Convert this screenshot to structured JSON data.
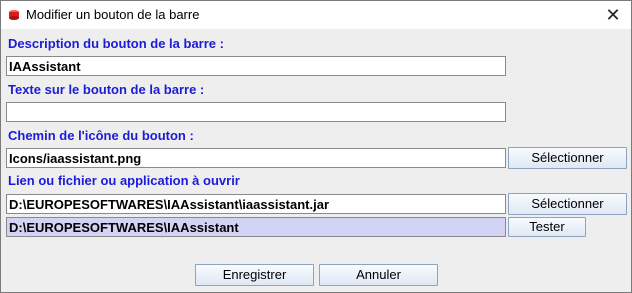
{
  "window": {
    "title": "Modifier un bouton de la barre",
    "close_glyph": "✕"
  },
  "form": {
    "description_label": "Description du bouton de la barre :",
    "description_value": "IAAssistant",
    "text_label": "Texte sur le bouton de la barre :",
    "text_value": "",
    "icon_path_label": "Chemin de l'icône du bouton :",
    "icon_path_value": "Icons/iaassistant.png",
    "icon_select_button": "Sélectionner",
    "link_label": "Lien ou fichier ou application à ouvrir",
    "link_value": "D:\\EUROPESOFTWARES\\IAAssistant\\iaassistant.jar",
    "link_select_button": "Sélectionner",
    "workdir_value": "D:\\EUROPESOFTWARES\\IAAssistant",
    "test_button": "Tester"
  },
  "footer": {
    "save_button": "Enregistrer",
    "cancel_button": "Annuler"
  },
  "colors": {
    "label_blue": "#1c1cd8",
    "highlight_field": "#d3d3f6",
    "app_icon_red": "#d81e1e"
  },
  "icons": {
    "app": "red-cylinder-icon",
    "close": "close-icon"
  }
}
